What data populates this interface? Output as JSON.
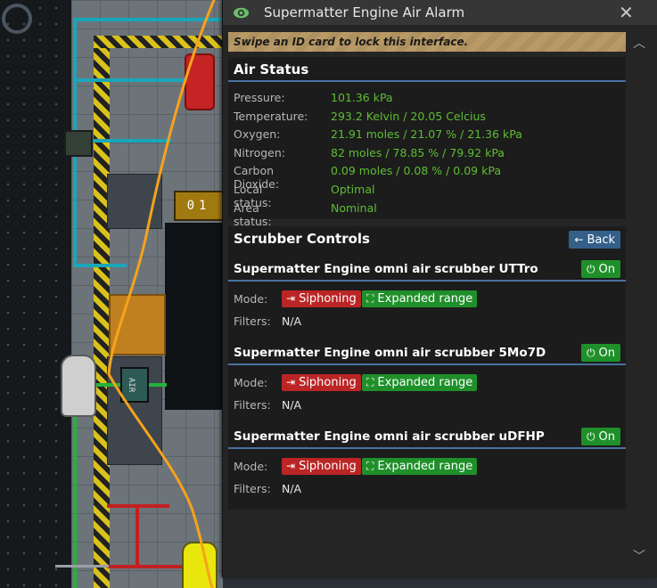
{
  "window": {
    "title": "Supermatter Engine Air Alarm",
    "eye_icon": "eye-icon",
    "close_glyph": "✕"
  },
  "notice": "Swipe an ID card to lock this interface.",
  "air_status": {
    "heading": "Air Status",
    "rows": [
      {
        "label": "Pressure:",
        "value": "101.36 kPa"
      },
      {
        "label": "Temperature:",
        "value": "293.2 Kelvin / 20.05 Celcius"
      },
      {
        "label": "Oxygen:",
        "value": "21.91 moles / 21.07 % / 21.36 kPa"
      },
      {
        "label": "Nitrogen:",
        "value": "82 moles / 78.85 % / 79.92 kPa"
      },
      {
        "label": "Carbon Dioxide:",
        "value": "0.09 moles / 0.08 % / 0.09 kPa"
      },
      {
        "label": "Local status:",
        "value": "Optimal"
      },
      {
        "label": "Area status:",
        "value": "Nominal"
      }
    ]
  },
  "scrubber_controls": {
    "heading": "Scrubber Controls",
    "back_label": "Back",
    "scrubbers": [
      {
        "name": "Supermatter Engine omni air scrubber UTTro",
        "power_label": "On",
        "mode_label": "Mode:",
        "siphon_label": "Siphoning",
        "range_label": "Expanded range",
        "filters_label": "Filters:",
        "filters_value": "N/A"
      },
      {
        "name": "Supermatter Engine omni air scrubber 5Mo7D",
        "power_label": "On",
        "mode_label": "Mode:",
        "siphon_label": "Siphoning",
        "range_label": "Expanded range",
        "filters_label": "Filters:",
        "filters_value": "N/A"
      },
      {
        "name": "Supermatter Engine omni air scrubber uDFHP",
        "power_label": "On",
        "mode_label": "Mode:",
        "siphon_label": "Siphoning",
        "range_label": "Expanded range",
        "filters_label": "Filters:",
        "filters_value": "N/A"
      }
    ]
  },
  "colors": {
    "accent_blue": "#4972a1",
    "value_green": "#5fbd33",
    "button_green": "#1f8f2a",
    "button_red": "#bb2525",
    "notice_tan": "#ae9160",
    "annotation_orange": "#f7a21b"
  },
  "game_labels": {
    "counter": "01",
    "console_tag": "AIR"
  }
}
